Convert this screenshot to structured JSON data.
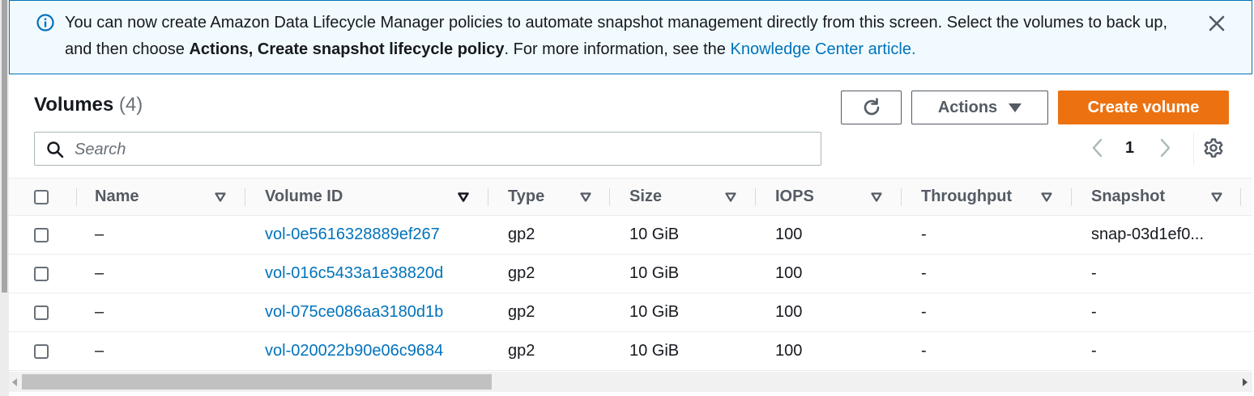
{
  "banner": {
    "text_before": "You can now create Amazon Data Lifecycle Manager policies to automate snapshot management directly from this screen. Select the volumes to back up, and then choose ",
    "bold_text": "Actions, Create snapshot lifecycle policy",
    "text_after": ". For more information, see the ",
    "link_text": "Knowledge Center article."
  },
  "header": {
    "title": "Volumes",
    "count": "(4)",
    "actions_label": "Actions",
    "create_label": "Create volume"
  },
  "search": {
    "placeholder": "Search",
    "value": ""
  },
  "pagination": {
    "current_page": "1"
  },
  "table": {
    "columns": [
      "Name",
      "Volume ID",
      "Type",
      "Size",
      "IOPS",
      "Throughput",
      "Snapshot"
    ],
    "rows": [
      {
        "name": "–",
        "volume_id": "vol-0e5616328889ef267",
        "type": "gp2",
        "size": "10 GiB",
        "iops": "100",
        "throughput": "-",
        "snapshot": "snap-03d1ef0..."
      },
      {
        "name": "–",
        "volume_id": "vol-016c5433a1e38820d",
        "type": "gp2",
        "size": "10 GiB",
        "iops": "100",
        "throughput": "-",
        "snapshot": "-"
      },
      {
        "name": "–",
        "volume_id": "vol-075ce086aa3180d1b",
        "type": "gp2",
        "size": "10 GiB",
        "iops": "100",
        "throughput": "-",
        "snapshot": "-"
      },
      {
        "name": "–",
        "volume_id": "vol-020022b90e06c9684",
        "type": "gp2",
        "size": "10 GiB",
        "iops": "100",
        "throughput": "-",
        "snapshot": "-"
      }
    ]
  },
  "colors": {
    "link": "#0073bb",
    "primary_button": "#ec7211",
    "banner_background": "#f1faff"
  },
  "icons": [
    "info-icon",
    "close-icon",
    "refresh-icon",
    "caret-down-icon",
    "search-icon",
    "chevron-left-icon",
    "chevron-right-icon",
    "gear-icon",
    "sort-icon"
  ]
}
